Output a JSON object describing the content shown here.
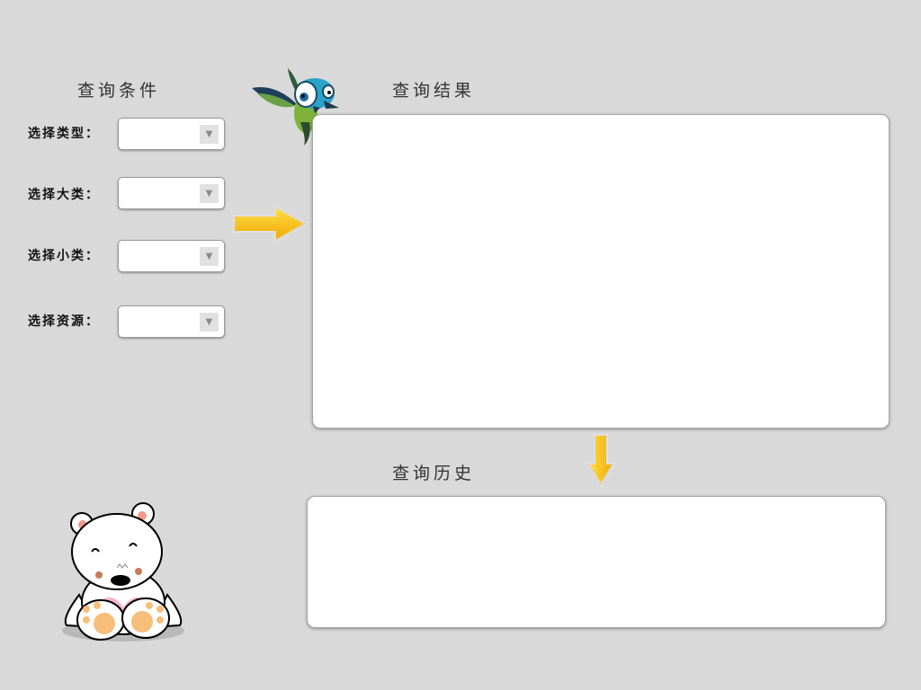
{
  "query_conditions": {
    "title": "查询条件",
    "fields": [
      {
        "label": "选择类型：",
        "value": ""
      },
      {
        "label": "选择大类：",
        "value": ""
      },
      {
        "label": "选择小类：",
        "value": ""
      },
      {
        "label": "选择资源：",
        "value": ""
      }
    ]
  },
  "query_results": {
    "title": "查询结果"
  },
  "query_history": {
    "title": "查询历史"
  },
  "icons": [
    "bird-icon",
    "right-arrow-icon",
    "down-arrow-icon",
    "bear-icon",
    "chevron-down-icon"
  ],
  "colors": {
    "background": "#d9d9d9",
    "arrow_yellow": "#f5b800",
    "panel_bg": "#ffffff"
  }
}
